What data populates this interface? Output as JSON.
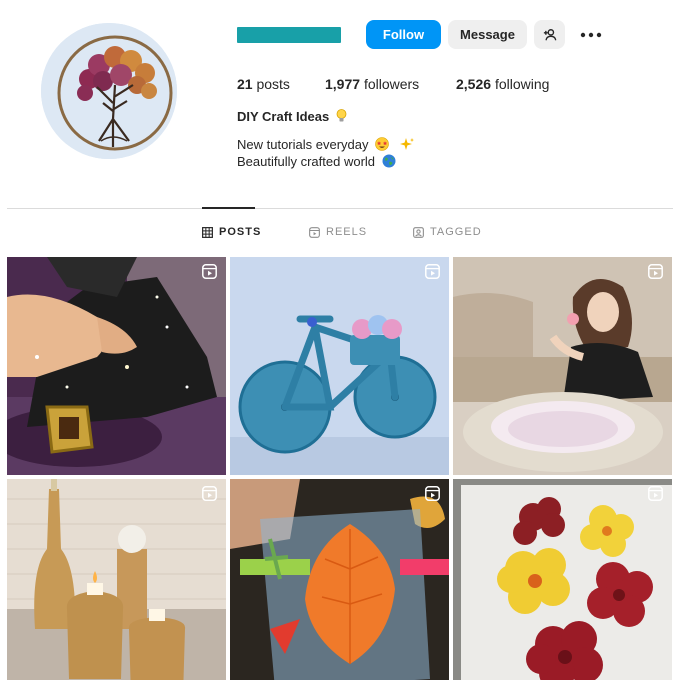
{
  "profile": {
    "follow_label": "Follow",
    "message_label": "Message",
    "stats": {
      "posts_count": "21",
      "posts_label": "posts",
      "followers_count": "1,977",
      "followers_label": "followers",
      "following_count": "2,526",
      "following_label": "following"
    },
    "display_name": "DIY Craft Ideas",
    "bio": [
      "New tutorials everyday",
      "Beautifully crafted world"
    ],
    "icons": {
      "avatar": "tree-of-life-wire-art",
      "suggest": "add-person-icon",
      "more": "more-options-icon",
      "name_emoji": "lightbulb-emoji",
      "bio_emoji_1": [
        "star-struck-emoji",
        "sparkles-emoji"
      ],
      "bio_emoji_2": "globe-emoji"
    },
    "colors": {
      "accent": "#0095f6",
      "username_redaction": "#18a0a8"
    }
  },
  "tabs": [
    {
      "label": "POSTS",
      "active": true,
      "icon": "grid-icon"
    },
    {
      "label": "REELS",
      "active": false,
      "icon": "reels-icon"
    },
    {
      "label": "TAGGED",
      "active": false,
      "icon": "tagged-icon"
    }
  ],
  "posts": [
    {
      "subject": "witch-hat-craft",
      "type": "reel"
    },
    {
      "subject": "string-art-bicycle",
      "type": "reel"
    },
    {
      "subject": "woman-making-rope-basket",
      "type": "reel"
    },
    {
      "subject": "gold-bottle-candle-decor",
      "type": "reel"
    },
    {
      "subject": "pressed-leaf-bookmark",
      "type": "reel"
    },
    {
      "subject": "resin-flower-petals",
      "type": "reel"
    }
  ]
}
